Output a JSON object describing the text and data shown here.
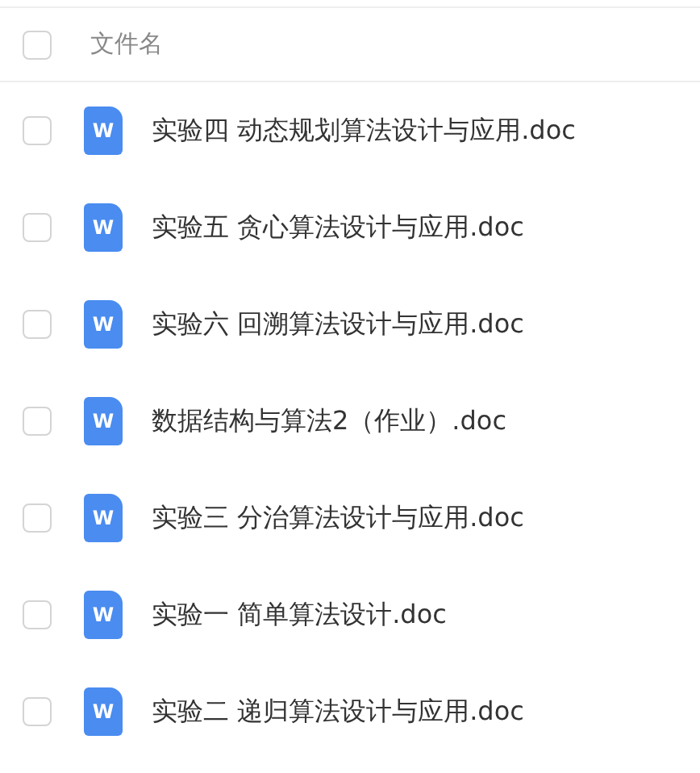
{
  "header": {
    "checked": false,
    "column": "文件名"
  },
  "files": [
    {
      "name": "实验四 动态规划算法设计与应用.doc",
      "icon_letter": "W",
      "checked": false
    },
    {
      "name": "实验五 贪心算法设计与应用.doc",
      "icon_letter": "W",
      "checked": false
    },
    {
      "name": "实验六 回溯算法设计与应用.doc",
      "icon_letter": "W",
      "checked": false
    },
    {
      "name": "数据结构与算法2（作业）.doc",
      "icon_letter": "W",
      "checked": false
    },
    {
      "name": "实验三 分治算法设计与应用.doc",
      "icon_letter": "W",
      "checked": false
    },
    {
      "name": "实验一 简单算法设计.doc",
      "icon_letter": "W",
      "checked": false
    },
    {
      "name": "实验二 递归算法设计与应用.doc",
      "icon_letter": "W",
      "checked": false
    }
  ]
}
